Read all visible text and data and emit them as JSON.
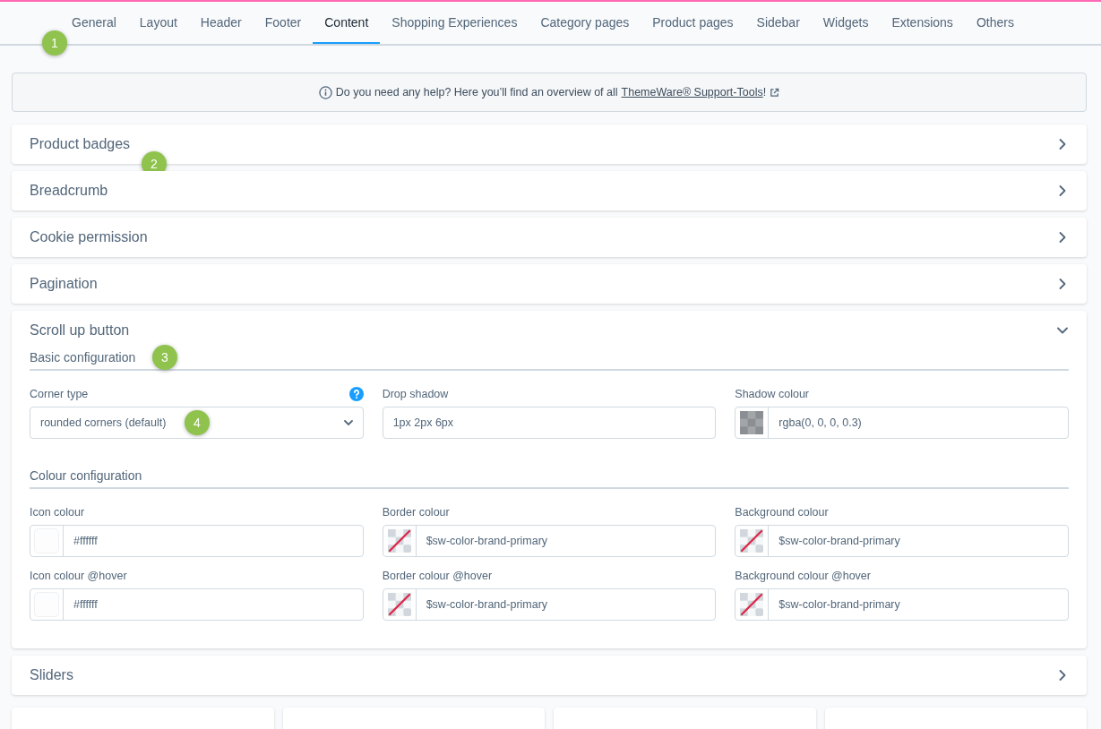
{
  "tabs": [
    {
      "label": "General",
      "selected": false
    },
    {
      "label": "Layout",
      "selected": false
    },
    {
      "label": "Header",
      "selected": false
    },
    {
      "label": "Footer",
      "selected": false
    },
    {
      "label": "Content",
      "selected": true
    },
    {
      "label": "Shopping Experiences",
      "selected": false
    },
    {
      "label": "Category pages",
      "selected": false
    },
    {
      "label": "Product pages",
      "selected": false
    },
    {
      "label": "Sidebar",
      "selected": false
    },
    {
      "label": "Widgets",
      "selected": false
    },
    {
      "label": "Extensions",
      "selected": false
    },
    {
      "label": "Others",
      "selected": false
    }
  ],
  "tabs_marker": "1",
  "help": {
    "text": "Do you need any help? Here you’ll find an overview of all",
    "link": "ThemeWare® Support-Tools",
    "after": "!"
  },
  "panels": [
    {
      "title": "Product badges",
      "expanded": false,
      "marker": "2"
    },
    {
      "title": "Breadcrumb",
      "expanded": false
    },
    {
      "title": "Cookie permission",
      "expanded": false
    },
    {
      "title": "Pagination",
      "expanded": false
    },
    {
      "title": "Scroll up button",
      "expanded": true,
      "sections": [
        {
          "title": "Basic configuration",
          "marker": "3",
          "fields": [
            {
              "kind": "select",
              "label": "Corner type",
              "value": "rounded corners (default)",
              "help": true,
              "marker": "4"
            },
            {
              "kind": "text",
              "label": "Drop shadow",
              "value": "1px 2px 6px"
            },
            {
              "kind": "color",
              "label": "Shadow colour",
              "value": "rgba(0, 0, 0, 0.3)",
              "swatch": {
                "kind": "checker"
              }
            }
          ]
        },
        {
          "title": "Colour configuration",
          "fields": [
            {
              "kind": "color",
              "label": "Icon colour",
              "value": "#ffffff",
              "swatch": {
                "kind": "white"
              }
            },
            {
              "kind": "color",
              "label": "Border colour",
              "value": "$sw-color-brand-primary",
              "swatch": {
                "kind": "none"
              }
            },
            {
              "kind": "color",
              "label": "Background colour",
              "value": "$sw-color-brand-primary",
              "swatch": {
                "kind": "none"
              }
            },
            {
              "kind": "color",
              "label": "Icon colour @hover",
              "value": "#ffffff",
              "swatch": {
                "kind": "white"
              }
            },
            {
              "kind": "color",
              "label": "Border colour @hover",
              "value": "$sw-color-brand-primary",
              "swatch": {
                "kind": "none"
              }
            },
            {
              "kind": "color",
              "label": "Background colour @hover",
              "value": "$sw-color-brand-primary",
              "swatch": {
                "kind": "none"
              }
            }
          ]
        }
      ]
    },
    {
      "title": "Sliders",
      "expanded": false
    }
  ]
}
